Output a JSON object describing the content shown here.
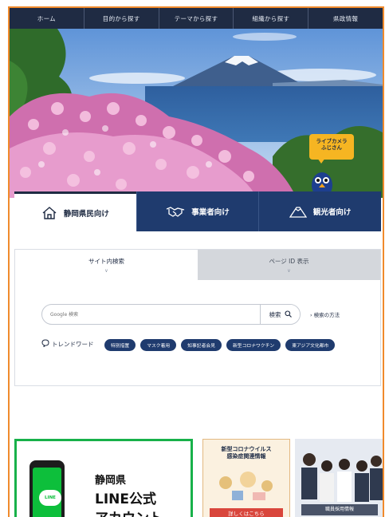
{
  "nav": {
    "items": [
      {
        "label": "ホーム"
      },
      {
        "label": "目的から探す"
      },
      {
        "label": "テーマから探す"
      },
      {
        "label": "組織から探す"
      },
      {
        "label": "県政情報"
      }
    ]
  },
  "hero": {
    "mascot_bubble_line1": "ライブカメラ",
    "mascot_bubble_line2": "ふじさん"
  },
  "audience_tabs": [
    {
      "label": "静岡県民向け",
      "icon": "house-icon"
    },
    {
      "label": "事業者向け",
      "icon": "handshake-icon"
    },
    {
      "label": "観光者向け",
      "icon": "mountain-icon"
    }
  ],
  "search": {
    "tabs": [
      {
        "label": "サイト内検索"
      },
      {
        "label": "ページ ID 表示"
      }
    ],
    "placeholder": "Google 検索",
    "button_label": "検索",
    "howto_label": "› 検索の方法"
  },
  "trend": {
    "label": "トレンドワード",
    "chips": [
      "特別措置",
      "マスク着用",
      "知事記者会見",
      "新型コロナワクチン",
      "東アジア文化都市"
    ]
  },
  "banners": {
    "line": {
      "phone_text": "LINE",
      "title_line1": "静岡県",
      "title_line2": "LINE公式",
      "title_line3": "アカウント"
    },
    "covid": {
      "title_line1": "新型コロナウイルス",
      "title_line2": "感染症関連情報",
      "button_label": "詳しくはこちら"
    },
    "staff": {
      "label": "職員採用情報"
    }
  },
  "colors": {
    "nav_bg": "#1f2b43",
    "accent_navy": "#1f3b6e",
    "border_orange": "#f08a2c",
    "line_green": "#18b14a"
  }
}
